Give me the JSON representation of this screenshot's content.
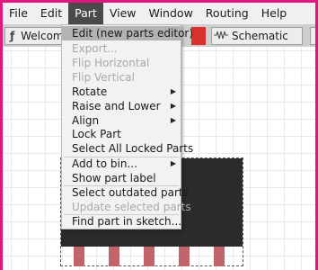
{
  "menubar": {
    "items": [
      {
        "label": "File"
      },
      {
        "label": "Edit"
      },
      {
        "label": "Part"
      },
      {
        "label": "View"
      },
      {
        "label": "Window"
      },
      {
        "label": "Routing"
      },
      {
        "label": "Help"
      }
    ],
    "active": "Part"
  },
  "tabs": {
    "welcome": {
      "label": "Welcome",
      "icon": "fritzing-f-icon"
    },
    "schematic": {
      "label": "Schematic",
      "icon": "schematic-resistor-icon"
    }
  },
  "part_menu": {
    "items": [
      {
        "label": "Edit (new parts editor)",
        "enabled": true,
        "submenu": false
      },
      {
        "label": "Export...",
        "enabled": false,
        "submenu": false
      },
      {
        "label": "Flip Horizontal",
        "enabled": false,
        "submenu": false
      },
      {
        "label": "Flip Vertical",
        "enabled": false,
        "submenu": false
      },
      {
        "label": "Rotate",
        "enabled": true,
        "submenu": true
      },
      {
        "label": "Raise and Lower",
        "enabled": true,
        "submenu": true
      },
      {
        "label": "Align",
        "enabled": true,
        "submenu": true
      },
      {
        "label": "Lock Part",
        "enabled": true,
        "submenu": false
      },
      {
        "label": "Select All Locked Parts",
        "enabled": true,
        "submenu": false
      },
      {
        "label": "Add to bin...",
        "enabled": true,
        "submenu": true
      },
      {
        "label": "Show part label",
        "enabled": true,
        "submenu": false
      },
      {
        "label": "Select outdated parts",
        "enabled": true,
        "submenu": false
      },
      {
        "label": "Update selected parts",
        "enabled": false,
        "submenu": false
      },
      {
        "label": "Find part in sketch...",
        "enabled": true,
        "submenu": false
      }
    ]
  },
  "colors": {
    "window_frame": "#e0187c",
    "menu_active": "#4a4a4a",
    "chip_body": "#2b2b2b",
    "chip_pins": "#c1646c",
    "tab_accent": "#d9322b"
  }
}
